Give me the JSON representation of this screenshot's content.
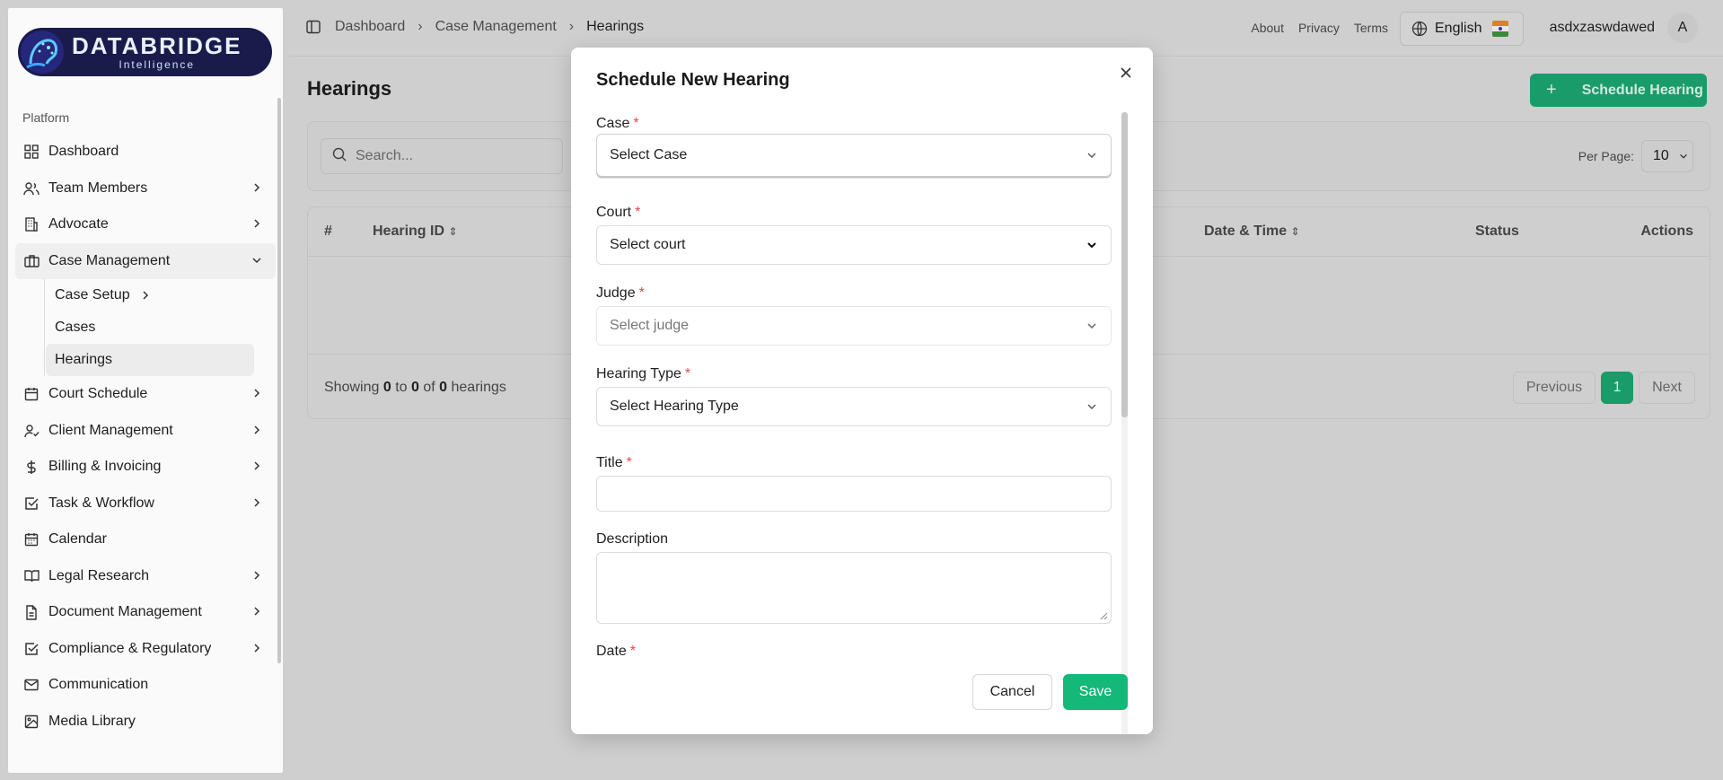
{
  "brand": {
    "title": "DATABRIDGE",
    "subtitle": "Intelligence"
  },
  "sidebar": {
    "section": "Platform",
    "items": [
      {
        "label": "Dashboard",
        "icon": "grid-icon"
      },
      {
        "label": "Team Members",
        "icon": "users-icon"
      },
      {
        "label": "Advocate",
        "icon": "building-icon"
      },
      {
        "label": "Case Management",
        "icon": "briefcase-icon"
      },
      {
        "label": "Court Schedule",
        "icon": "calendar-icon"
      },
      {
        "label": "Client Management",
        "icon": "user-check-icon"
      },
      {
        "label": "Billing & Invoicing",
        "icon": "dollar-icon"
      },
      {
        "label": "Task & Workflow",
        "icon": "checkbox-icon"
      },
      {
        "label": "Calendar",
        "icon": "calendar-icon"
      },
      {
        "label": "Legal Research",
        "icon": "book-icon"
      },
      {
        "label": "Document Management",
        "icon": "file-icon"
      },
      {
        "label": "Compliance & Regulatory",
        "icon": "checkbox-icon"
      },
      {
        "label": "Communication",
        "icon": "mail-icon"
      },
      {
        "label": "Media Library",
        "icon": "image-icon"
      }
    ],
    "sub_items": [
      {
        "label": "Case Setup"
      },
      {
        "label": "Cases"
      },
      {
        "label": "Hearings"
      }
    ]
  },
  "topbar": {
    "breadcrumbs": [
      "Dashboard",
      "Case Management",
      "Hearings"
    ],
    "links": [
      "About",
      "Privacy",
      "Terms"
    ],
    "language": "English",
    "username": "asdxzaswdawed",
    "avatar_initial": "A"
  },
  "page": {
    "title": "Hearings",
    "schedule_button": "Schedule Hearing",
    "search_placeholder": "Search...",
    "per_page_label": "Per Page:",
    "per_page_value": "10",
    "columns": [
      "#",
      "Hearing ID",
      "Date & Time",
      "Status",
      "Actions"
    ],
    "showing_prefix": "Showing",
    "showing_from": "0",
    "showing_to_word": "to",
    "showing_to": "0",
    "showing_of_word": "of",
    "showing_total": "0",
    "showing_suffix": "hearings",
    "pager": {
      "prev": "Previous",
      "page": "1",
      "next": "Next"
    }
  },
  "modal": {
    "title": "Schedule New Hearing",
    "fields": {
      "case": {
        "label": "Case",
        "value": "Select Case"
      },
      "court": {
        "label": "Court",
        "value": "Select court"
      },
      "judge": {
        "label": "Judge",
        "value": "Select judge"
      },
      "hearing_type": {
        "label": "Hearing Type",
        "value": "Select Hearing Type"
      },
      "title": {
        "label": "Title",
        "value": ""
      },
      "description": {
        "label": "Description",
        "value": ""
      },
      "date": {
        "label": "Date"
      }
    },
    "required_mark": "*",
    "cancel": "Cancel",
    "save": "Save"
  },
  "colors": {
    "accent": "#14b879",
    "brand_bg": "#1a1b4b",
    "required": "#e5484d"
  }
}
